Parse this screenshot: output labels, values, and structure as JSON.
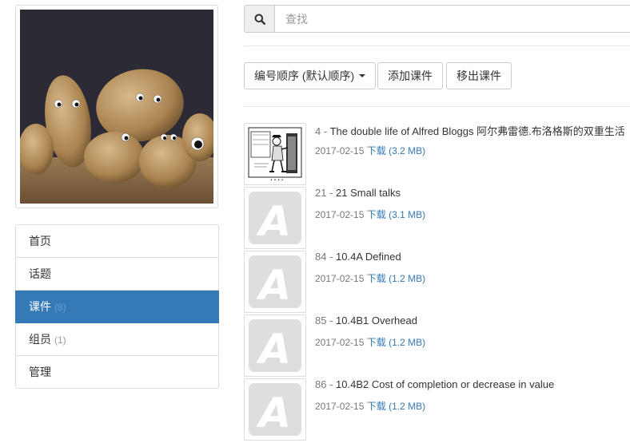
{
  "nav": [
    {
      "label": "首页",
      "count": ""
    },
    {
      "label": "话题",
      "count": ""
    },
    {
      "label": "课件",
      "count": "(8)",
      "active": true
    },
    {
      "label": "组员",
      "count": "(1)"
    },
    {
      "label": "管理",
      "count": ""
    }
  ],
  "search": {
    "placeholder": "查找"
  },
  "toolbar": {
    "sort_label": "编号顺序 (默认顺序)",
    "add_label": "添加课件",
    "remove_label": "移出课件"
  },
  "items": [
    {
      "num": "4 -",
      "title": "The double life of Alfred Bloggs 阿尔弗雷德.布洛格斯的双重生活",
      "date": "2017-02-15",
      "download": "下载",
      "size": "(3.2 MB)",
      "thumb": "comic"
    },
    {
      "num": "21 -",
      "title": "21 Small talks",
      "date": "2017-02-15",
      "download": "下载",
      "size": "(3.1 MB)",
      "thumb": "letter-a"
    },
    {
      "num": "84 -",
      "title": "10.4A Defined",
      "date": "2017-02-15",
      "download": "下载",
      "size": "(1.2 MB)",
      "thumb": "letter-a"
    },
    {
      "num": "85 -",
      "title": "10.4B1 Overhead",
      "date": "2017-02-15",
      "download": "下载",
      "size": "(1.2 MB)",
      "thumb": "letter-a"
    },
    {
      "num": "86 -",
      "title": "10.4B2 Cost of completion or decrease in value",
      "date": "2017-02-15",
      "download": "下载",
      "size": "(1.2 MB)",
      "thumb": "letter-a"
    }
  ],
  "colors": {
    "accent": "#337ab7",
    "link": "#337ab7",
    "border": "#dddddd"
  }
}
